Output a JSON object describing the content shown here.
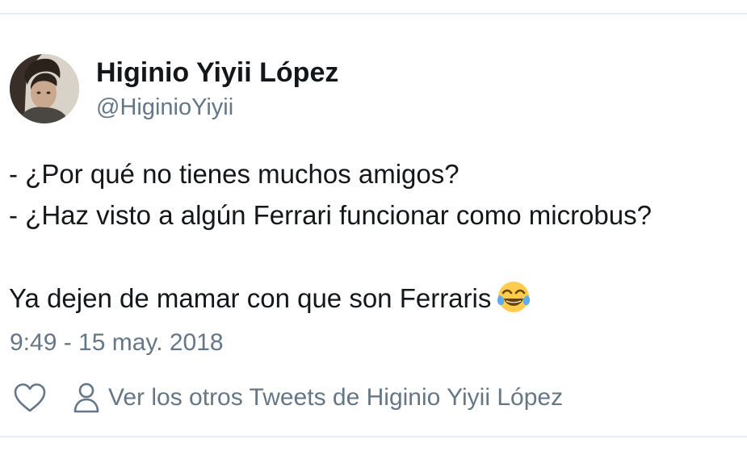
{
  "tweet": {
    "author": {
      "display_name": "Higinio Yiyii López",
      "handle": "@HiginioYiyii"
    },
    "text_lines": [
      "- ¿Por qué no tienes muchos amigos?",
      "- ¿Haz visto a algún Ferrari funcionar como microbus?",
      "Ya dejen de mamar con que son Ferraris"
    ],
    "emoji": "face-with-tears-of-joy",
    "timestamp": "9:49 - 15 may. 2018",
    "actions": {
      "like_icon": "heart-icon",
      "profile_icon": "person-icon",
      "profile_link_label": "Ver los otros Tweets de Higinio Yiyii López"
    }
  },
  "colors": {
    "text_primary": "#14171a",
    "text_secondary": "#657786",
    "divider": "#e6ecf0"
  }
}
